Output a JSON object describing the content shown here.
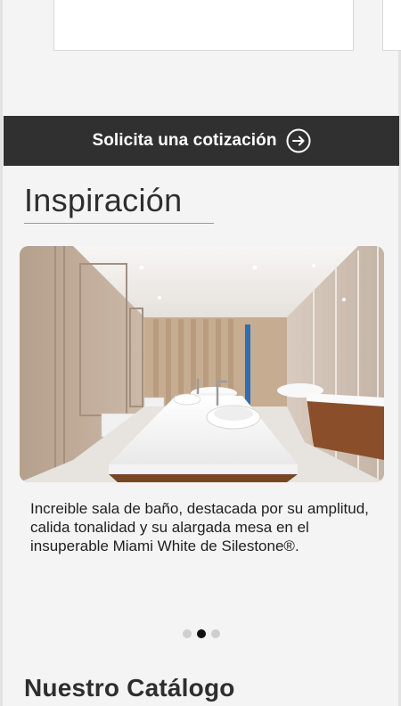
{
  "quote_cta": {
    "label": "Solicita una cotización",
    "icon": "arrow-right-circle-icon"
  },
  "inspiration": {
    "title": "Inspiración",
    "slide": {
      "image": "bathroom-interior-photo",
      "caption": "Increible sala de baño, destacada por su amplitud, calida tonalidad y su alargada mesa en el insuperable Miami White de Silestone®."
    },
    "carousel": {
      "total": 3,
      "active_index": 1
    }
  },
  "catalog": {
    "title": "Nuestro Catálogo"
  },
  "colors": {
    "cta_bg": "#303030",
    "page_bg": "#f4f4f4",
    "dot_active": "#111111",
    "dot_inactive": "#cfcfcf"
  }
}
